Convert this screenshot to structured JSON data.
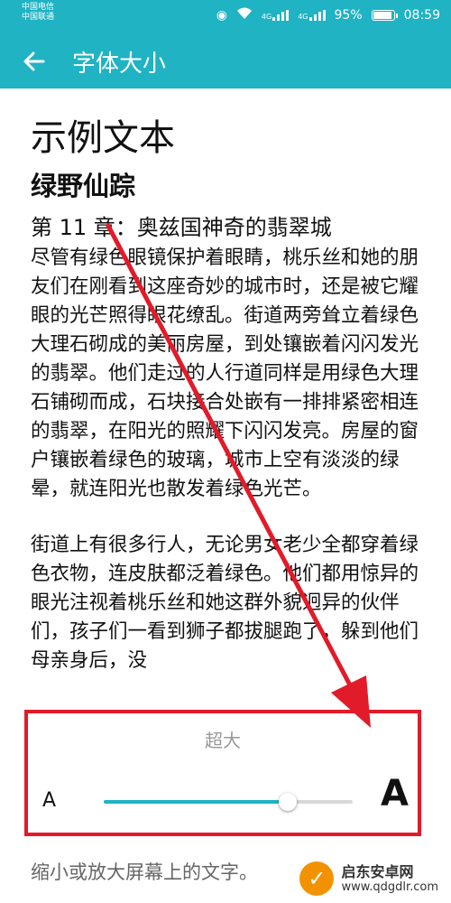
{
  "status_bar": {
    "carriers": [
      "中国电信",
      "中国联通"
    ],
    "signal_1": "4G",
    "signal_2": "4G",
    "battery": "95%",
    "time": "08:59"
  },
  "app_bar": {
    "back_icon": "back-arrow-icon",
    "title": "字体大小"
  },
  "sample": {
    "heading": "示例文本",
    "book_title": "绿野仙踪",
    "chapter": "第 11 章：奥兹国神奇的翡翠城",
    "paragraphs": [
      "尽管有绿色眼镜保护着眼睛，桃乐丝和她的朋友们在刚看到这座奇妙的城市时，还是被它耀眼的光芒照得眼花缭乱。街道两旁耸立着绿色大理石砌成的美丽房屋，到处镶嵌着闪闪发光的翡翠。他们走过的人行道同样是用绿色大理石铺砌而成，石块接合处嵌有一排排紧密相连的翡翠，在阳光的照耀下闪闪发亮。房屋的窗户镶嵌着绿色的玻璃，城市上空有淡淡的绿晕，就连阳光也散发着绿色光芒。",
      "街道上有很多行人，无论男女老少全都穿着绿色衣物，连皮肤都泛着绿色。他们都用惊异的眼光注视着桃乐丝和她这群外貌迥异的伙伴们，孩子们一看到狮子都拔腿跑了，躲到他们母亲身后，没"
    ]
  },
  "font_size_control": {
    "current_level_label": "超大",
    "small_glyph": "A",
    "large_glyph": "A",
    "slider_fraction": 0.74,
    "accent_color": "#1fb3c4"
  },
  "hint": "缩小或放大屏幕上的文字。",
  "watermark": {
    "line1": "启东安卓网",
    "line2": "www.qdgdlr.com"
  }
}
